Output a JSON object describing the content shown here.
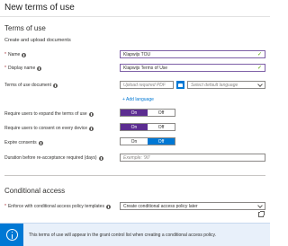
{
  "header": {
    "title": "New terms of use"
  },
  "terms_section": {
    "title": "Terms of use",
    "subtitle": "Create and upload documents"
  },
  "name_field": {
    "label": "Name",
    "value": "Klapwijs TOU"
  },
  "display_name_field": {
    "label": "Display name",
    "value": "Klapwijs Terms of Use"
  },
  "document_field": {
    "label": "Terms of use document",
    "upload_placeholder": "Upload required PDF",
    "language_placeholder": "Select default language",
    "add_language": "+ Add language"
  },
  "expand_toggle": {
    "label": "Require users to expand the terms of use",
    "on": "On",
    "off": "Off",
    "selected": "On"
  },
  "consent_toggle": {
    "label": "Require users to consent on every device",
    "on": "On",
    "off": "Off",
    "selected": "On"
  },
  "expire_toggle": {
    "label": "Expire consents",
    "on": "On",
    "off": "Off",
    "selected": "Off"
  },
  "duration_field": {
    "label": "Duration before re-acceptance required (days)",
    "placeholder": "Exemple: '90'"
  },
  "conditional_section": {
    "title": "Conditional access"
  },
  "policy_field": {
    "label": "Enforce with conditional access policy templates",
    "value": "Create conditional access policy later"
  },
  "info_bar": {
    "message": "This terms of use will appear in the grant control list when creating a conditional access policy."
  },
  "colors": {
    "accent": "#0078d4",
    "toggle_on": "#5c2d91",
    "required": "#a4262c",
    "check": "#57a300"
  }
}
